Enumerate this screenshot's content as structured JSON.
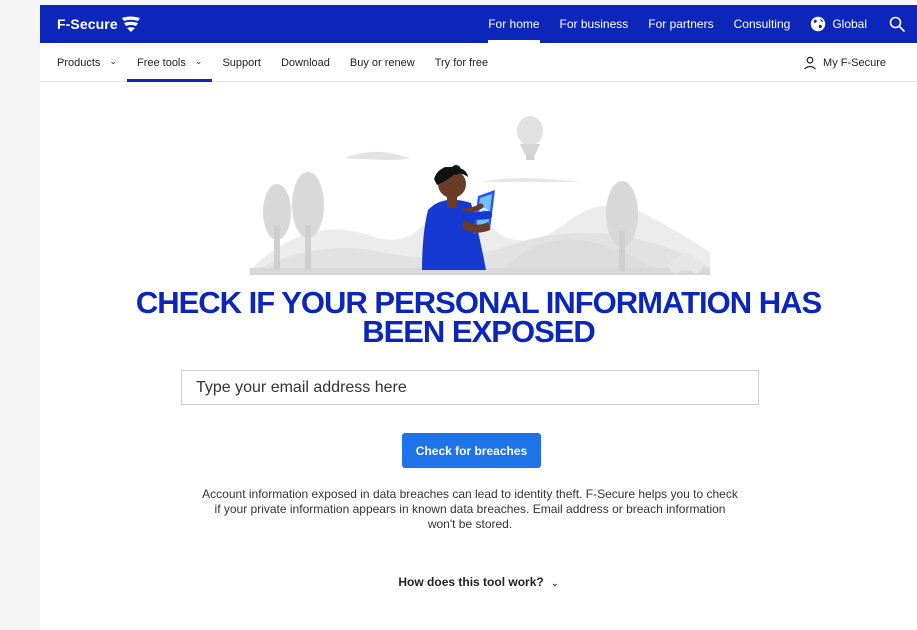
{
  "brand": {
    "name": "F-Secure",
    "primary_color": "#0b26b8",
    "button_color": "#1e73e8"
  },
  "topnav": {
    "items": [
      "For home",
      "For business",
      "For partners",
      "Consulting"
    ],
    "active": "For home",
    "global_label": "Global",
    "search_icon": "search-icon"
  },
  "subnav": {
    "items": [
      {
        "label": "Products",
        "chevron": true
      },
      {
        "label": "Free tools",
        "chevron": true
      },
      {
        "label": "Support",
        "chevron": false
      },
      {
        "label": "Download",
        "chevron": false
      },
      {
        "label": "Buy or renew",
        "chevron": false
      },
      {
        "label": "Try for free",
        "chevron": false
      }
    ],
    "active": "Free tools",
    "account_label": "My F-Secure"
  },
  "hero": {
    "headline_line1": "CHECK IF YOUR PERSONAL INFORMATION HAS",
    "headline_line2": "BEEN EXPOSED",
    "email_placeholder": "Type your email address here",
    "button_label": "Check for breaches",
    "info_text": "Account information exposed in data breaches can lead to identity theft. F-Secure helps you to check if your private information appears in known data breaches. Email address or breach information won't be stored.",
    "how_label": "How does this tool work?"
  }
}
